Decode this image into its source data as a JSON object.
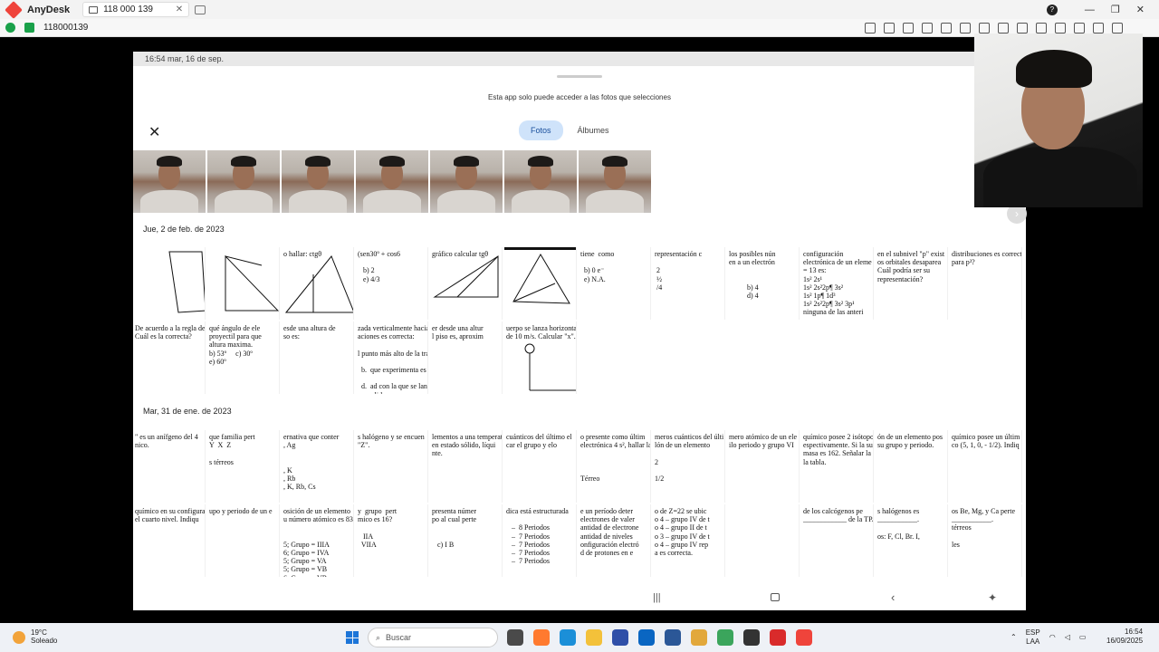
{
  "anydesk": {
    "app_name": "AnyDesk",
    "tab_title": "118 000 139",
    "address_id": "118000139"
  },
  "phone": {
    "status_time": "16:54  mar, 16 de sep.",
    "notice": "Esta app solo puede acceder a las fotos que selecciones",
    "tabs": {
      "photos": "Fotos",
      "albums": "Álbumes"
    },
    "section_1_date": "Jue, 2 de feb. de 2023",
    "section_2_date": "Mar, 31 de ene. de 2023",
    "row1": [
      "",
      "",
      "o hallar: ctgθ",
      "(sen30º + cos6\n\n   b) 2\n   e) 4/3",
      "gráfico calcular tgθ",
      "",
      "tiene  como\n\n  b) 0 e⁻\n  e) N.A.",
      "representación c\n\n 2\n ½\n /4",
      "los posibles nún\nen a un electrón\n\n\n          b) 4\n          d) 4",
      "configuración\nelectrónica de un eleme\n= 13 es:\n1s² 2s¹\n1s² 2s²2p¶ 3s²\n1s² 1p¶ 1d³\n1s² 2s²2p¶ 3s² 3p¹\nninguna de las anteri",
      "en el subnivel \"p\" exist\nos orbitales desaparea\nCuál podría ser su\nrepresentación?",
      "distribuciones es correcta\npara p³?"
    ],
    "row2": [
      "De acuerdo a la regla de Hun\nCuál es la correcta?",
      "qué ángulo de ele\nproyectil para que\naltura maxima.\nb) 53º     c) 30º\ne) 60º",
      "esde una altura de\nso es:",
      "zada verticalmente hacia arriba\naciones es correcta:\n\nl punto más alto de la trayecto\n\n  b.  que experimenta es mayor có\n\n  d.  ad con la que se lanza es la misma\n      salida.\n      bida es mayor que el de bajada.",
      "er desde una altur\nl piso es, aproxim",
      "uerpo se lanza horizontalmente\nde 10 m/s. Calcular \"x\"."
    ],
    "row3": [
      "\" es un anífgeno del 4\nnico.",
      "que familia pert\nY  X  Z\n\ns térreos",
      "ernativa que conter\n, Ag\n\n\n, K\n, Rb\n, K, Rb, Cs",
      "s halógeno y se encuen\n\"Z\".",
      "lementos a una temperat\nen estado sólido, líqui\nnte.",
      "cuánticos del último el\ncar el grupo y elo",
      "o presente como últim\nelectrónica 4 s², hallar la\n\n\n\nTérreo",
      "meros cuánticos del últi\nlón de un elemento\n\n2\n\n1/2",
      "mero atómico de un ele\nilo periodo y grupo VI",
      "químico posee 2 isótopos\nespectivamente. Si la su\nmasa es 162. Señalar la\nla tabla.",
      "ón de un elemento pos\nsu grupo y periodo.",
      "químico posee un últim\nco (5, 1, 0, - 1/2). Indiq"
    ],
    "row4": [
      "químico en su configura\nel cuarto nivel. Indiqu",
      "upo y periodo de un e",
      "osición de un elemento\nu número atómico es 83\n\n\n5; Grupo = IIIA\n6; Grupo = IVA\n5; Grupo = VA\n5; Grupo = VB\n6; Grupo = VB",
      "y  grupo  pert\nmico es 16?\n\n   IIA\n  VIIA",
      "presenta númer\npo al cual perte\n\n\n   c) I B",
      "dica está estructurada\n\n   –  8 Periodos\n   –  7 Periodos\n   –  7 Periodos\n   –  7 Periodos\n   –  7 Periodos",
      "e un período deter\nelectrones de valer\nantidad de electrone\nantidad de niveles\nonfiguración electró\nd de protones en e",
      "o de Z=22 se ubic\no 4 – grupo IV de t\no 4 – grupo II de t\no 3 – grupo IV de t\no 4 – grupo IV rep\na es correcta.",
      "",
      "de los calcógenos pe\n____________ de la TPA.",
      "s halógenos es\n___________.\n\nos: F, Cl, Br. I,",
      "os Be, Mg, y Ca perte\n___________.\ntérreos\n\nles"
    ]
  },
  "taskbar": {
    "temperature": "19°C",
    "condition": "Soleado",
    "search_placeholder": "Buscar",
    "lang_1": "ESP",
    "lang_2": "LAA",
    "time": "16:54",
    "date": "16/09/2025"
  }
}
